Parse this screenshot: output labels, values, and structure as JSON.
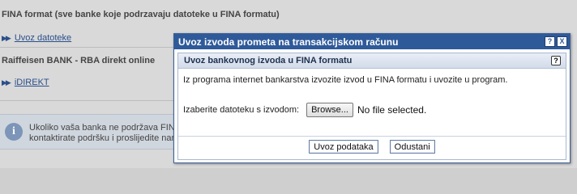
{
  "background": {
    "heading_fina": "FINA format (sve banke koje podrzavaju datoteke u FINA formatu)",
    "link_uvoz": "Uvoz datoteke",
    "heading_raiffeisen": "Raiffeisen BANK - RBA direkt online",
    "link_idirekt": "iDIREKT",
    "info_line1": "Ukoliko vaša banka ne podržava FINA",
    "info_line2": "kontaktirate podršku i proslijedite nam"
  },
  "dialog": {
    "title": "Uvoz izvoda prometa na transakcijskom računu",
    "help_btn": "?",
    "close_btn": "X",
    "section_title": "Uvoz bankovnog izvoda u FINA formatu",
    "section_help": "?",
    "description": "Iz programa internet bankarstva izvozite izvod u FINA formatu i uvozite u program.",
    "file_label": "Izaberite datoteku s izvodom:",
    "browse_label": "Browse...",
    "no_file_text": "No file selected.",
    "import_button": "Uvoz podataka",
    "cancel_button": "Odustani"
  },
  "colors": {
    "titlebar": "#2f5a9a",
    "link": "#2a4f8a",
    "info_icon": "#7c95b8"
  },
  "icons": {
    "link_arrow": "double-chevron-right-icon",
    "info": "info-icon",
    "help": "question-icon",
    "close": "close-icon"
  }
}
